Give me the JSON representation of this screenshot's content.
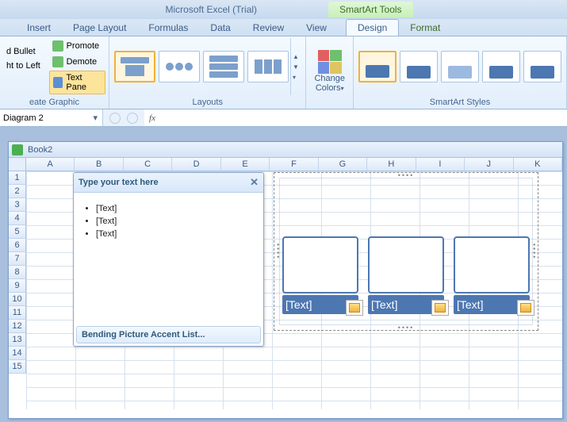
{
  "title": {
    "app": "Microsoft Excel (Trial)",
    "contextual": "SmartArt Tools"
  },
  "tabs": {
    "insert": "Insert",
    "pagelayout": "Page Layout",
    "formulas": "Formulas",
    "data": "Data",
    "review": "Review",
    "view": "View",
    "design": "Design",
    "format": "Format"
  },
  "ribbon": {
    "create": {
      "bullet": "d Bullet",
      "rtl": "ht to Left",
      "promote": "Promote",
      "demote": "Demote",
      "textpane": "Text Pane",
      "label": "eate Graphic"
    },
    "layouts": {
      "label": "Layouts"
    },
    "colors": {
      "label": "Change Colors",
      "line1": "Change",
      "line2": "Colors"
    },
    "styles": {
      "label": "SmartArt Styles"
    }
  },
  "namebox": {
    "value": "Diagram 2"
  },
  "fx": {
    "label": "fx",
    "value": ""
  },
  "book": {
    "title": "Book2"
  },
  "columns": [
    "A",
    "B",
    "C",
    "D",
    "E",
    "F",
    "G",
    "H",
    "I",
    "J",
    "K"
  ],
  "rows": [
    "1",
    "2",
    "3",
    "4",
    "5",
    "6",
    "7",
    "8",
    "9",
    "10",
    "11",
    "12",
    "13",
    "14",
    "15"
  ],
  "textpane": {
    "header": "Type your text here",
    "items": [
      "[Text]",
      "[Text]",
      "[Text]"
    ],
    "footer": "Bending Picture Accent List..."
  },
  "smartart": {
    "captions": [
      "[Text]",
      "[Text]",
      "[Text]"
    ]
  },
  "colors": {
    "accent": "#4d77b1",
    "ribbon": "#e2eefb"
  }
}
